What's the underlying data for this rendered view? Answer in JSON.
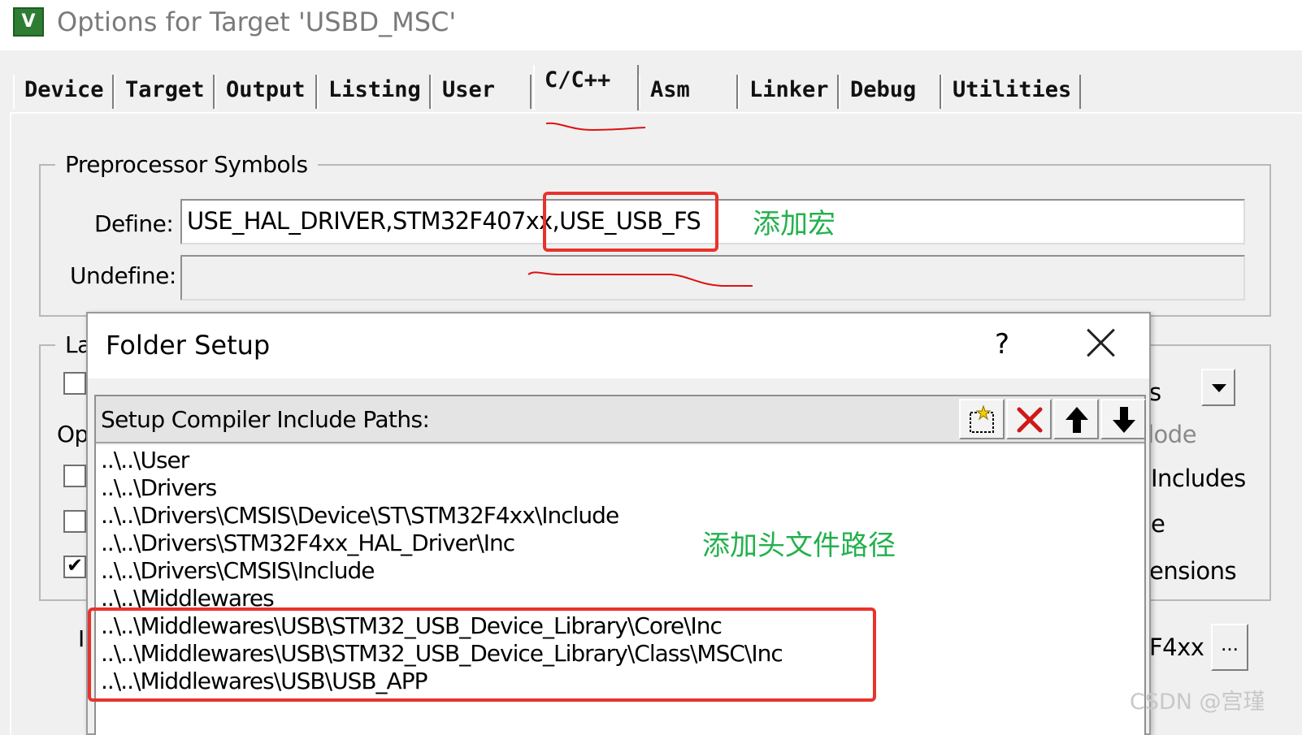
{
  "window": {
    "title": "Options for Target 'USBD_MSC'",
    "app_icon_glyph": "V"
  },
  "tabs": [
    {
      "label": "Device"
    },
    {
      "label": "Target"
    },
    {
      "label": "Output"
    },
    {
      "label": "Listing"
    },
    {
      "label": "User"
    },
    {
      "label": "C/C++"
    },
    {
      "label": "Asm"
    },
    {
      "label": "Linker"
    },
    {
      "label": "Debug"
    },
    {
      "label": "Utilities"
    }
  ],
  "active_tab": "C/C++",
  "preprocessor": {
    "group_title": "Preprocessor Symbols",
    "define_label": "Define:",
    "define_value": "USE_HAL_DRIVER,STM32F407xx,USE_USB_FS",
    "define_value_part1": "USE_HAL_DRIVER,STM32F407xx",
    "define_value_part2": "USE_USB_FS",
    "undefine_label": "Undefine:",
    "undefine_value": ""
  },
  "background_partial": {
    "group_title_fragment": "La",
    "options_fragment": "Op",
    "combo_fragment": "s",
    "mode_fragment": "lode",
    "includes_fragment": "Includes",
    "e_fragment": "e",
    "extensions_fragment": "ensions",
    "device_fragment": "F4xx",
    "i_fragment": "I",
    "browse_label": "..."
  },
  "dialog": {
    "title": "Folder Setup",
    "help_label": "?",
    "list_label": "Setup Compiler Include Paths:",
    "toolbar": [
      {
        "name": "new-folder-icon"
      },
      {
        "name": "delete-icon"
      },
      {
        "name": "move-up-icon"
      },
      {
        "name": "move-down-icon"
      }
    ],
    "paths": [
      "..\\..\\User",
      "..\\..\\Drivers",
      "..\\..\\Drivers\\CMSIS\\Device\\ST\\STM32F4xx\\Include",
      "..\\..\\Drivers\\STM32F4xx_HAL_Driver\\Inc",
      "..\\..\\Drivers\\CMSIS\\Include",
      "..\\..\\Middlewares",
      "..\\..\\Middlewares\\USB\\STM32_USB_Device_Library\\Core\\Inc",
      "..\\..\\Middlewares\\USB\\STM32_USB_Device_Library\\Class\\MSC\\Inc",
      "..\\..\\Middlewares\\USB\\USB_APP"
    ]
  },
  "annotations": {
    "add_macro": "添加宏",
    "add_header_path": "添加头文件路径",
    "highlight_color": "#e8322c",
    "text_color": "#22b14c"
  },
  "watermark": "CSDN @宫瑾"
}
